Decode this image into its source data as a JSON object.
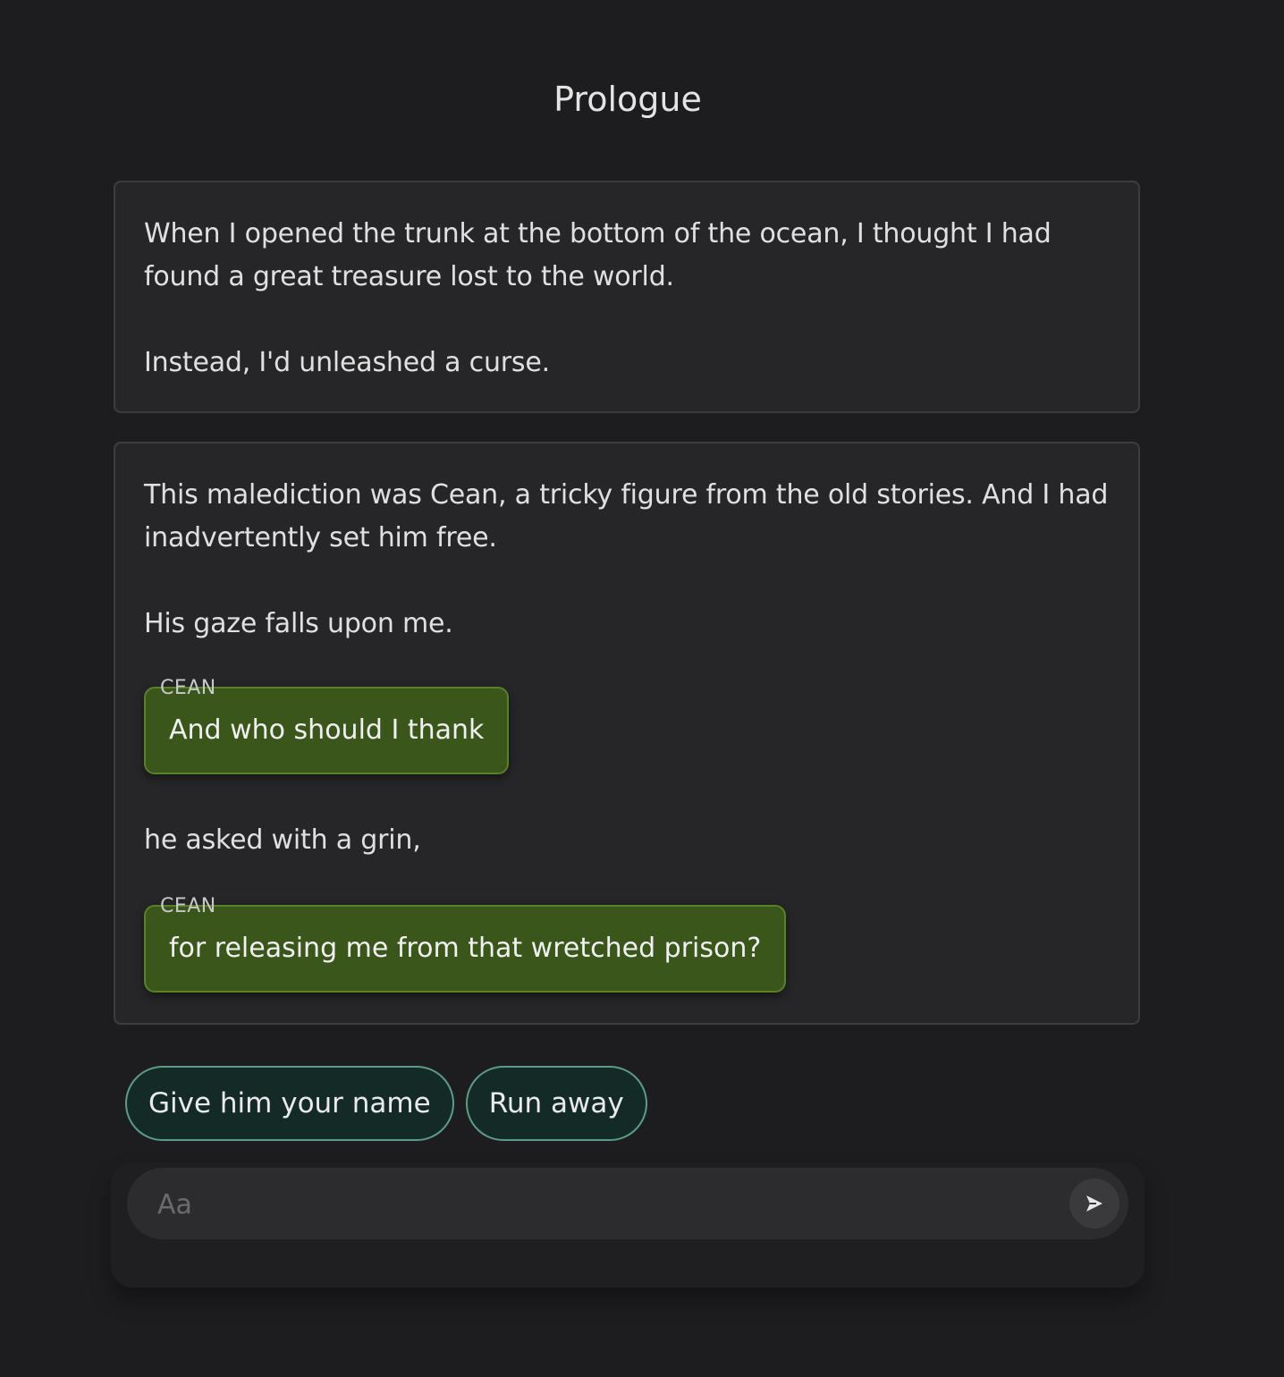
{
  "header": {
    "title": "Prologue"
  },
  "story": {
    "card1": {
      "paragraphs": [
        "When I opened the trunk at the bottom of the ocean, I thought I had found a great treasure lost to the world.",
        "Instead, I'd unleashed a curse."
      ]
    },
    "card2": {
      "paragraph1": "This malediction was Cean, a tricky figure from the old stories. And I had inadvertently set him free.",
      "paragraph2": "His gaze falls upon me.",
      "dialogue1": {
        "speaker": "CEAN",
        "text": "And who should I thank"
      },
      "narration": "he asked with a grin,",
      "dialogue2": {
        "speaker": "CEAN",
        "text": "for releasing me from that wretched prison?"
      }
    }
  },
  "choices": [
    {
      "label": "Give him your name"
    },
    {
      "label": "Run away"
    }
  ],
  "composer": {
    "placeholder": "Aa",
    "send_icon": "send-arrow-icon"
  },
  "colors": {
    "background": "#1d1d1f",
    "card": "#262628",
    "dialogue_bubble": "#3a561b",
    "choice_button": "#142a27",
    "choice_border": "#5c9c86"
  }
}
